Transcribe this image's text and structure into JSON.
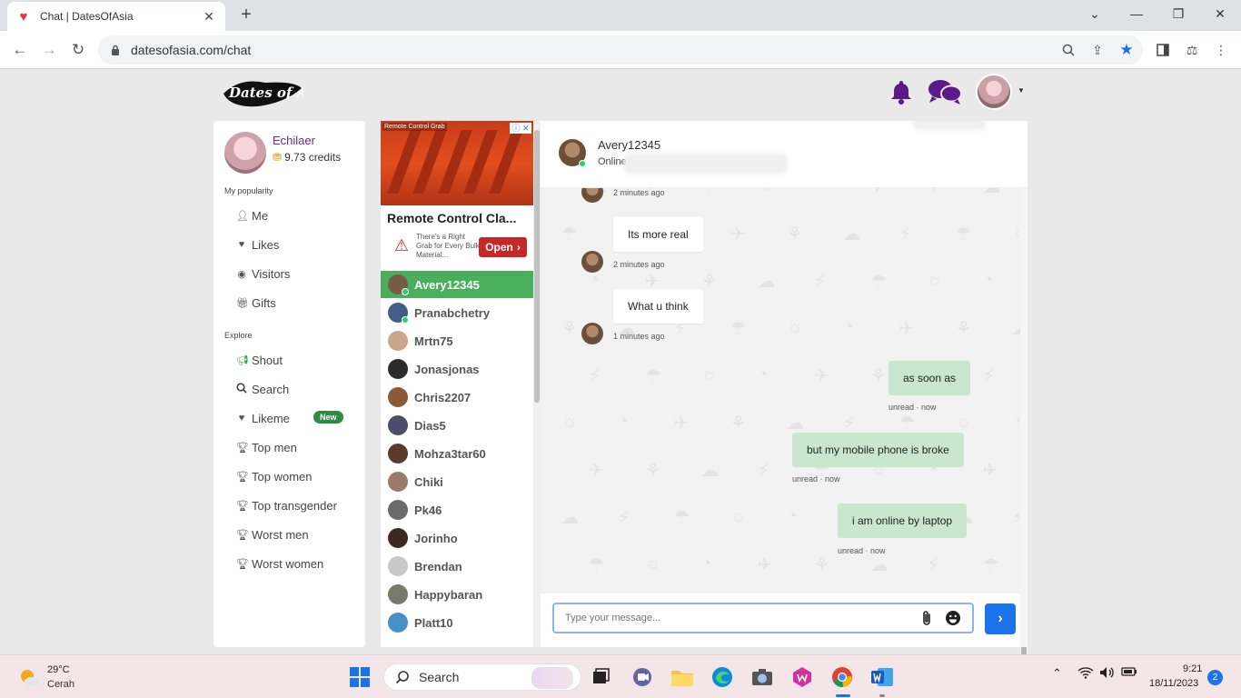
{
  "browser": {
    "tab_title": "Chat | DatesOfAsia",
    "url": "datesofasia.com/chat",
    "new_tab": "+",
    "close": "✕"
  },
  "site": {
    "logo_text": "Dates of Asia"
  },
  "profile": {
    "name": "Echilaer",
    "credits": "9.73 credits"
  },
  "sidebar": {
    "popularity_label": "My popularity",
    "popularity_items": [
      {
        "label": "Me",
        "icon": "user-icon"
      },
      {
        "label": "Likes",
        "icon": "heart-icon"
      },
      {
        "label": "Visitors",
        "icon": "eye-icon"
      },
      {
        "label": "Gifts",
        "icon": "gift-icon"
      }
    ],
    "explore_label": "Explore",
    "explore_items": [
      {
        "label": "Shout",
        "icon": "megaphone-icon"
      },
      {
        "label": "Search",
        "icon": "search-icon"
      },
      {
        "label": "Likeme",
        "icon": "heart-icon"
      },
      {
        "label": "Top men",
        "icon": "trophy-icon"
      },
      {
        "label": "Top women",
        "icon": "trophy-icon"
      },
      {
        "label": "Top transgender",
        "icon": "trophy-icon"
      },
      {
        "label": "Worst men",
        "icon": "trophy-icon"
      },
      {
        "label": "Worst women",
        "icon": "trophy-icon"
      }
    ],
    "new_badge": "New"
  },
  "ad": {
    "image_label": "Remote Control Grab",
    "title": "Remote Control Cla...",
    "text": "There's a Right Grab for Every Bulk Material...",
    "open_label": "Open"
  },
  "contacts": [
    {
      "name": "Avery12345",
      "online": true,
      "active": true,
      "color": "#7a5a45"
    },
    {
      "name": "Pranabchetry",
      "online": true,
      "active": false,
      "color": "#3f5f86"
    },
    {
      "name": "Mrtn75",
      "online": false,
      "active": false,
      "color": "#c9a58a"
    },
    {
      "name": "Jonasjonas",
      "online": false,
      "active": false,
      "color": "#2b2b2b"
    },
    {
      "name": "Chris2207",
      "online": false,
      "active": false,
      "color": "#8a5a3a"
    },
    {
      "name": "Dias5",
      "online": false,
      "active": false,
      "color": "#4a4e6a"
    },
    {
      "name": "Mohza3tar60",
      "online": false,
      "active": false,
      "color": "#5a3a2a"
    },
    {
      "name": "Chiki",
      "online": false,
      "active": false,
      "color": "#9a7a6a"
    },
    {
      "name": "Pk46",
      "online": false,
      "active": false,
      "color": "#6a6a6a"
    },
    {
      "name": "Jorinho",
      "online": false,
      "active": false,
      "color": "#3a2a22"
    },
    {
      "name": "Brendan",
      "online": false,
      "active": false,
      "color": "#c8c8c8"
    },
    {
      "name": "Happybaran",
      "online": false,
      "active": false,
      "color": "#7a7a6a"
    },
    {
      "name": "Platt10",
      "online": false,
      "active": false,
      "color": "#4a90c8"
    }
  ],
  "chat": {
    "partner_name": "Avery12345",
    "partner_status": "Online",
    "messages_in": [
      {
        "text": "",
        "time": "2 minutes ago"
      },
      {
        "text": "Its more real",
        "time": "2 minutes ago"
      },
      {
        "text": "What u think",
        "time": "1 minutes ago"
      }
    ],
    "messages_out": [
      {
        "text": "as soon as",
        "meta": "unread · now"
      },
      {
        "text": "but my mobile phone is broke",
        "meta": "unread · now"
      },
      {
        "text": "i am online by laptop",
        "meta": "unread · now"
      }
    ],
    "input_placeholder": "Type your message...",
    "send_icon": "›"
  },
  "taskbar": {
    "temperature": "29°C",
    "weather": "Cerah",
    "search_label": "Search",
    "time": "9:21",
    "date": "18/11/2023",
    "notifications": "2"
  },
  "colors": {
    "brand_purple": "#5b1a8a",
    "active_green": "#4aae5d",
    "send_blue": "#1a73e8"
  }
}
